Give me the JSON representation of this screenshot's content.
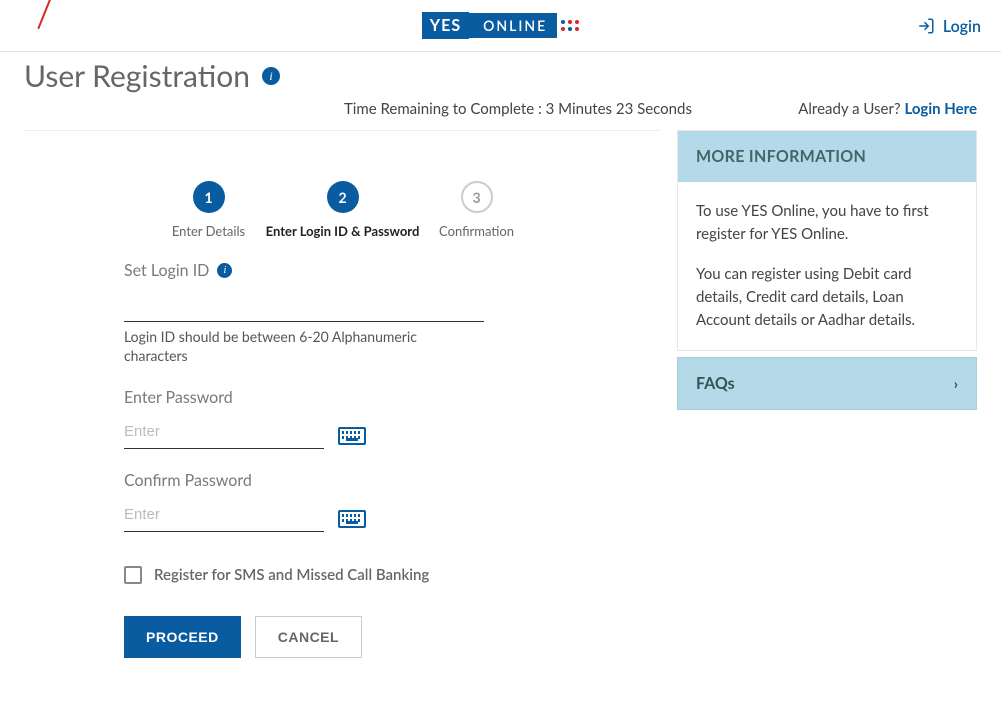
{
  "header": {
    "logo_primary": "YES",
    "logo_secondary": "ONLINE",
    "login_label": "Login"
  },
  "page": {
    "title": "User Registration",
    "time_text": "Time Remaining to Complete : 3 Minutes 23 Seconds",
    "already_prefix": "Already a User? ",
    "already_link": "Login Here"
  },
  "stepper": {
    "steps": [
      {
        "num": "1",
        "label": "Enter Details",
        "state": "done"
      },
      {
        "num": "2",
        "label": "Enter Login ID & Password",
        "state": "active"
      },
      {
        "num": "3",
        "label": "Confirmation",
        "state": "pending"
      }
    ]
  },
  "form": {
    "login_id": {
      "label": "Set Login ID",
      "hint": "Login ID should be between 6-20 Alphanumeric characters",
      "value": ""
    },
    "password": {
      "label": "Enter Password",
      "placeholder": "Enter",
      "value": ""
    },
    "confirm_password": {
      "label": "Confirm Password",
      "placeholder": "Enter",
      "value": ""
    },
    "sms_checkbox_label": "Register for SMS and Missed Call Banking",
    "proceed_label": "PROCEED",
    "cancel_label": "CANCEL"
  },
  "sidebar": {
    "more_info_header": "MORE INFORMATION",
    "more_info_p1": "To use YES Online, you have to first register for YES Online.",
    "more_info_p2": "You can register using Debit card details, Credit card details, Loan Account details or Aadhar details.",
    "faqs_label": "FAQs"
  }
}
